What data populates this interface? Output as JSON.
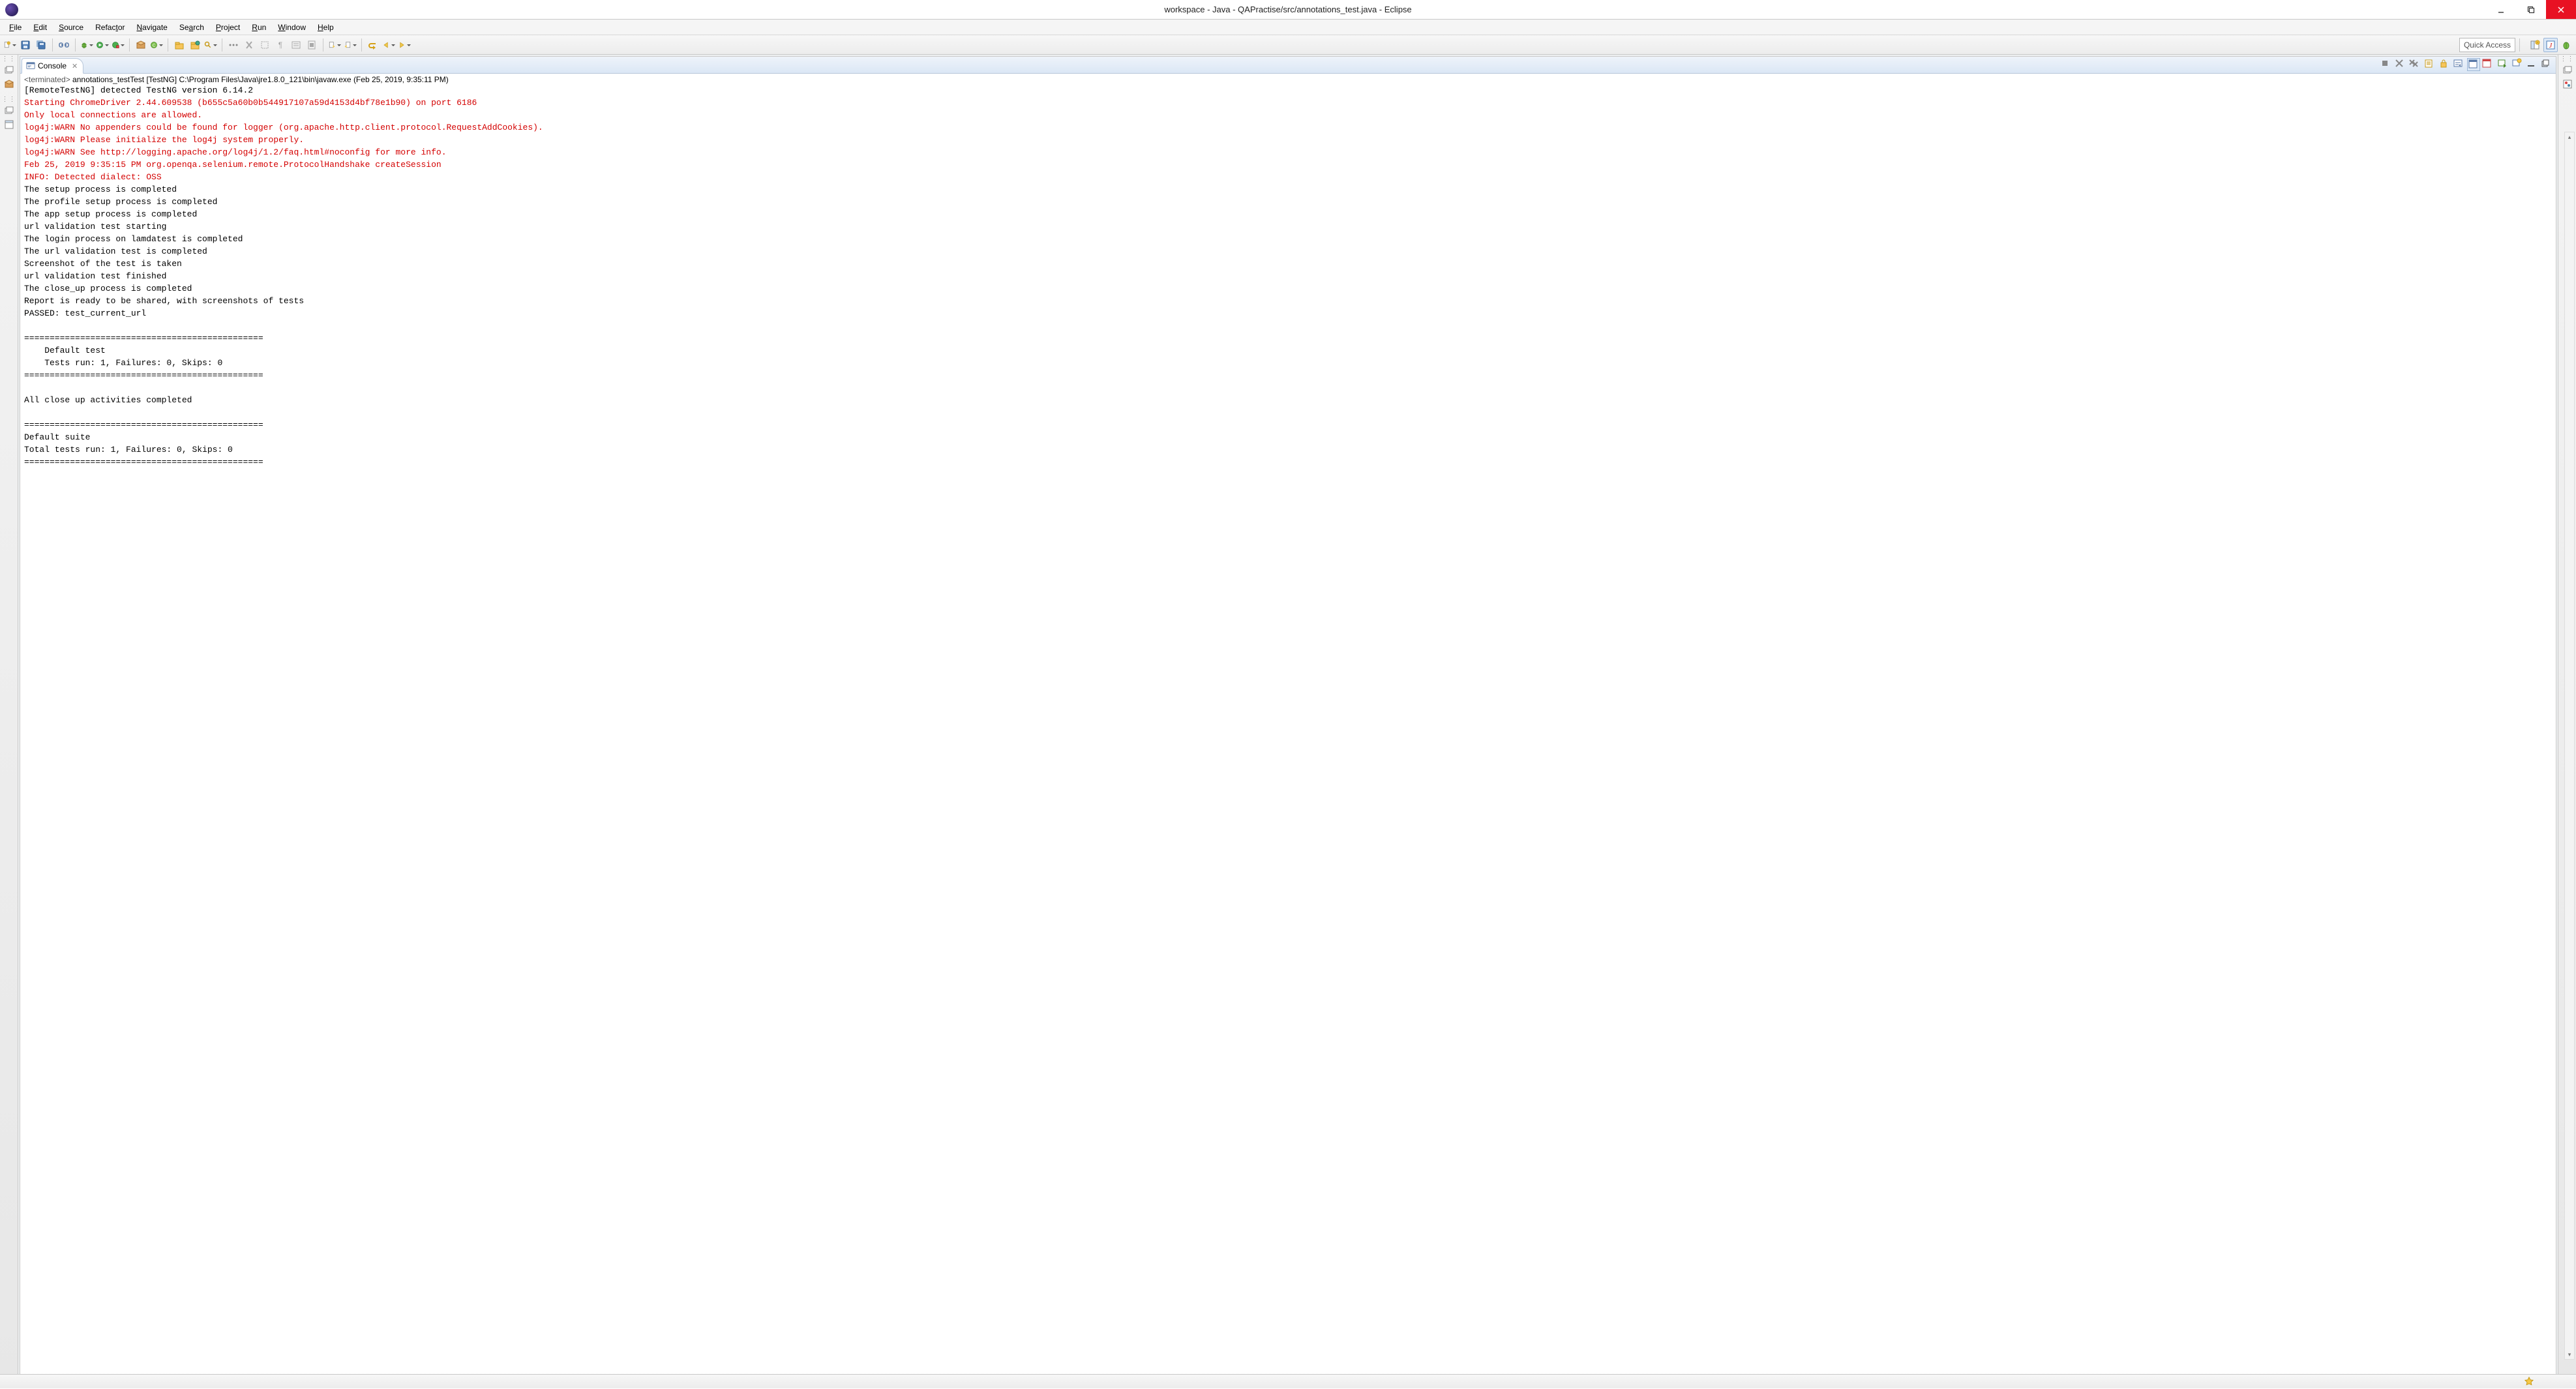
{
  "window": {
    "title": "workspace - Java - QAPractise/src/annotations_test.java - Eclipse"
  },
  "menu": {
    "items": [
      "File",
      "Edit",
      "Source",
      "Refactor",
      "Navigate",
      "Search",
      "Project",
      "Run",
      "Window",
      "Help"
    ]
  },
  "toolbar": {
    "quick_access_placeholder": "Quick Access"
  },
  "console": {
    "tab_label": "Console",
    "terminated_prefix": "<terminated>",
    "desc_main": " annotations_testTest [TestNG] C:\\Program Files\\Java\\jre1.8.0_121\\bin\\javaw.exe (Feb 25, 2019, 9:35:11 PM)",
    "lines": [
      {
        "t": "out",
        "s": "[RemoteTestNG] detected TestNG version 6.14.2"
      },
      {
        "t": "err",
        "s": "Starting ChromeDriver 2.44.609538 (b655c5a60b0b544917107a59d4153d4bf78e1b90) on port 6186"
      },
      {
        "t": "err",
        "s": "Only local connections are allowed."
      },
      {
        "t": "err",
        "s": "log4j:WARN No appenders could be found for logger (org.apache.http.client.protocol.RequestAddCookies)."
      },
      {
        "t": "err",
        "s": "log4j:WARN Please initialize the log4j system properly."
      },
      {
        "t": "err",
        "s": "log4j:WARN See http://logging.apache.org/log4j/1.2/faq.html#noconfig for more info."
      },
      {
        "t": "err",
        "s": "Feb 25, 2019 9:35:15 PM org.openqa.selenium.remote.ProtocolHandshake createSession"
      },
      {
        "t": "err",
        "s": "INFO: Detected dialect: OSS"
      },
      {
        "t": "out",
        "s": "The setup process is completed"
      },
      {
        "t": "out",
        "s": "The profile setup process is completed"
      },
      {
        "t": "out",
        "s": "The app setup process is completed"
      },
      {
        "t": "out",
        "s": "url validation test starting"
      },
      {
        "t": "out",
        "s": "The login process on lamdatest is completed"
      },
      {
        "t": "out",
        "s": "The url validation test is completed"
      },
      {
        "t": "out",
        "s": "Screenshot of the test is taken"
      },
      {
        "t": "out",
        "s": "url validation test finished"
      },
      {
        "t": "out",
        "s": "The close_up process is completed"
      },
      {
        "t": "out",
        "s": "Report is ready to be shared, with screenshots of tests"
      },
      {
        "t": "out",
        "s": "PASSED: test_current_url"
      },
      {
        "t": "out",
        "s": ""
      },
      {
        "t": "out",
        "s": "==============================================="
      },
      {
        "t": "out",
        "s": "    Default test"
      },
      {
        "t": "out",
        "s": "    Tests run: 1, Failures: 0, Skips: 0"
      },
      {
        "t": "out",
        "s": "==============================================="
      },
      {
        "t": "out",
        "s": ""
      },
      {
        "t": "out",
        "s": "All close up activities completed"
      },
      {
        "t": "out",
        "s": ""
      },
      {
        "t": "out",
        "s": "==============================================="
      },
      {
        "t": "out",
        "s": "Default suite"
      },
      {
        "t": "out",
        "s": "Total tests run: 1, Failures: 0, Skips: 0"
      },
      {
        "t": "out",
        "s": "==============================================="
      }
    ]
  }
}
